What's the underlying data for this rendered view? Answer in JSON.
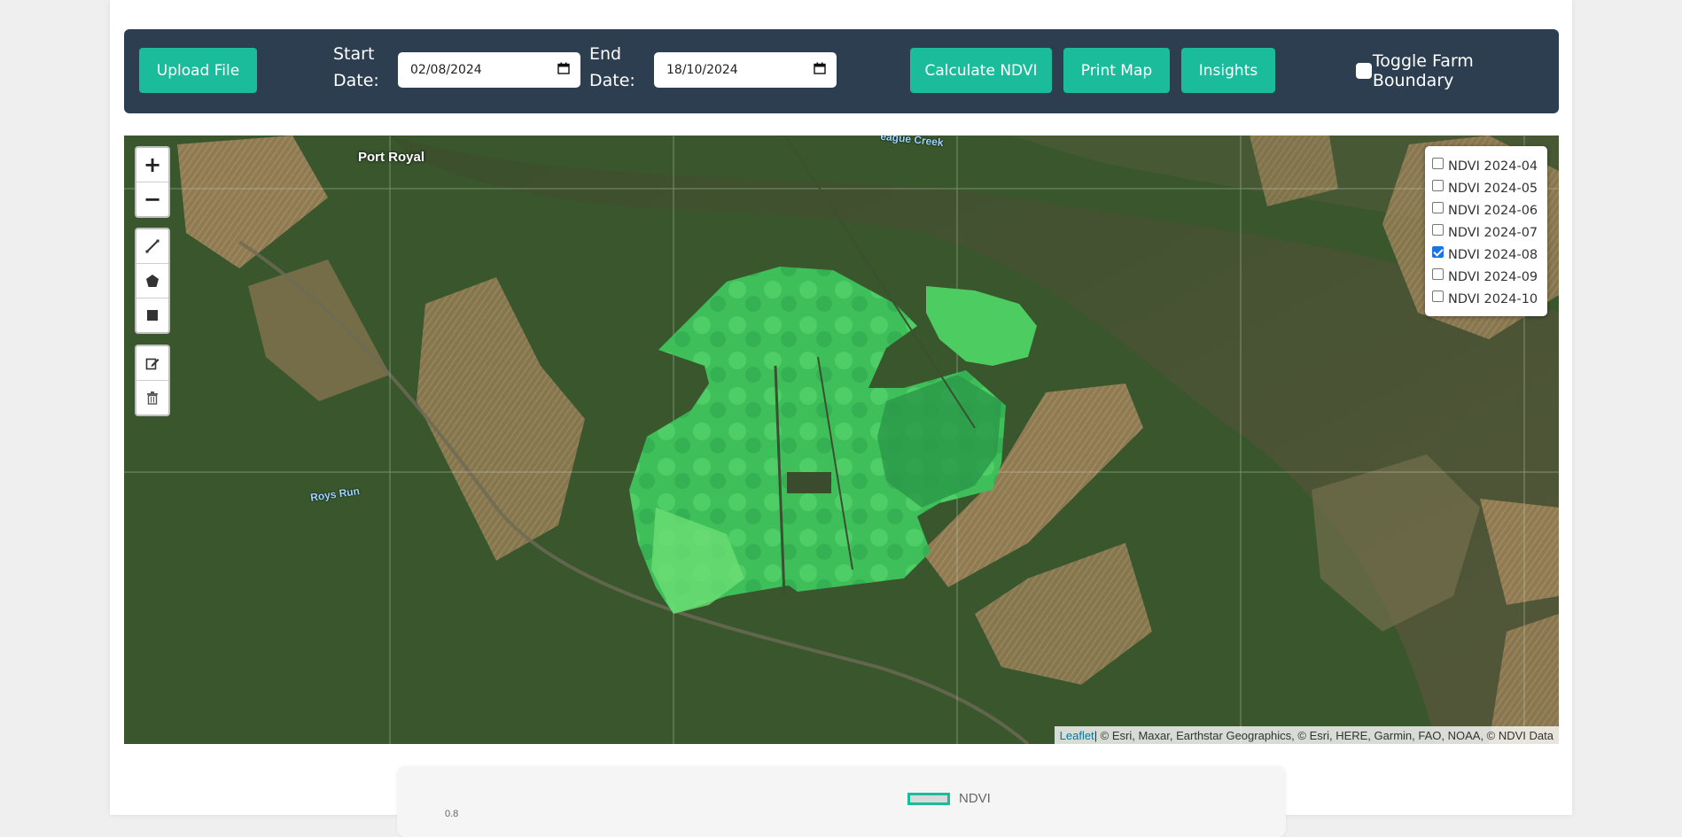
{
  "toolbar": {
    "upload_label": "Upload File",
    "start_label": "Start Date:",
    "start_value": "02/08/2024",
    "end_label": "End Date:",
    "end_value": "18/10/2024",
    "calculate_label": "Calculate NDVI",
    "print_label": "Print Map",
    "insights_label": "Insights",
    "toggle_label": "Toggle Farm Boundary",
    "toggle_checked": false
  },
  "map": {
    "place_labels": [
      "Port Royal",
      "Roys Run",
      "League Creek"
    ],
    "layers": [
      {
        "label": "NDVI 2024-04",
        "checked": false
      },
      {
        "label": "NDVI 2024-05",
        "checked": false
      },
      {
        "label": "NDVI 2024-06",
        "checked": false
      },
      {
        "label": "NDVI 2024-07",
        "checked": false
      },
      {
        "label": "NDVI 2024-08",
        "checked": true
      },
      {
        "label": "NDVI 2024-09",
        "checked": false
      },
      {
        "label": "NDVI 2024-10",
        "checked": false
      }
    ],
    "attribution_link": "Leaflet",
    "attribution_text": " | © Esri, Maxar, Earthstar Geographics, © Esri, HERE, Garmin, FAO, NOAA, © NDVI Data"
  },
  "controls": {
    "zoom_in": "+",
    "zoom_out": "−"
  },
  "chart": {
    "legend_label": "NDVI",
    "first_tick": "0.8"
  },
  "colors": {
    "toolbar_bg": "#2c3e50",
    "accent": "#1abc9c",
    "ndvi_high": "#2e9e4a",
    "ndvi_low": "#5fd46a"
  }
}
